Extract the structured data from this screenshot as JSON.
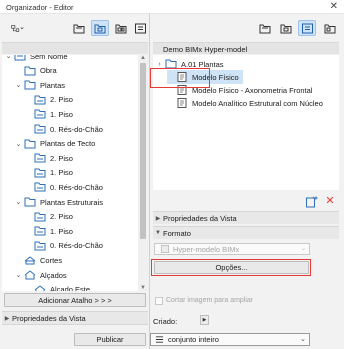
{
  "window": {
    "title": "Organizador - Editor",
    "close_glyph": "✕"
  },
  "left": {
    "header": "Sem Nome",
    "tree": [
      {
        "label": "Sem Nome",
        "level": 0,
        "twisty": "⌄",
        "icon": "project"
      },
      {
        "label": "Obra",
        "level": 1,
        "twisty": "",
        "icon": "folder"
      },
      {
        "label": "Plantas",
        "level": 1,
        "twisty": "⌄",
        "icon": "folder"
      },
      {
        "label": "2. Piso",
        "level": 2,
        "twisty": "",
        "icon": "floor"
      },
      {
        "label": "1. Piso",
        "level": 2,
        "twisty": "",
        "icon": "floor"
      },
      {
        "label": "0. Rés-do-Chão",
        "level": 2,
        "twisty": "",
        "icon": "floor"
      },
      {
        "label": "Plantas de Tecto",
        "level": 1,
        "twisty": "⌄",
        "icon": "folder"
      },
      {
        "label": "2. Piso",
        "level": 2,
        "twisty": "",
        "icon": "floor"
      },
      {
        "label": "1. Piso",
        "level": 2,
        "twisty": "",
        "icon": "floor"
      },
      {
        "label": "0. Rés-do-Chão",
        "level": 2,
        "twisty": "",
        "icon": "floor"
      },
      {
        "label": "Plantas Estruturais",
        "level": 1,
        "twisty": "⌄",
        "icon": "folder"
      },
      {
        "label": "2. Piso",
        "level": 2,
        "twisty": "",
        "icon": "floor"
      },
      {
        "label": "1. Piso",
        "level": 2,
        "twisty": "",
        "icon": "floor"
      },
      {
        "label": "0. Rés-do-Chão",
        "level": 2,
        "twisty": "",
        "icon": "floor"
      },
      {
        "label": "Cortes",
        "level": 1,
        "twisty": "",
        "icon": "section"
      },
      {
        "label": "Alçados",
        "level": 1,
        "twisty": "⌄",
        "icon": "elevation"
      },
      {
        "label": "Alçado Este",
        "level": 2,
        "twisty": "",
        "icon": "elevation"
      }
    ],
    "add_shortcut": "Adicionar Atalho > > >",
    "view_props": "Propriedades da Vista"
  },
  "right": {
    "header": "Demo BIMx Hyper-model",
    "tree": [
      {
        "label": "A.01 Plantas",
        "level": 0,
        "twisty": "›",
        "icon": "folder"
      },
      {
        "label": "Modelo Físico",
        "level": 1,
        "twisty": "",
        "icon": "page",
        "selected": true
      },
      {
        "label": "Modelo Físico - Axonometria Frontal",
        "level": 1,
        "twisty": "",
        "icon": "page"
      },
      {
        "label": "Modelo Analítico Estrutural com Núcleo",
        "level": 1,
        "twisty": "",
        "icon": "page"
      }
    ],
    "view_props": "Propriedades da Vista",
    "format": "Formato",
    "format_value": "Hyper-modelo BIMx",
    "options": "Opções...",
    "crop_label": "Cortar imagem para ampliar",
    "created_label": "Criado:",
    "scope_value": "conjunto inteiro",
    "publish": "Publicar"
  },
  "colors": {
    "highlight": "#e53935",
    "selection": "#cfe3f7",
    "folder": "#2e6fb7"
  }
}
